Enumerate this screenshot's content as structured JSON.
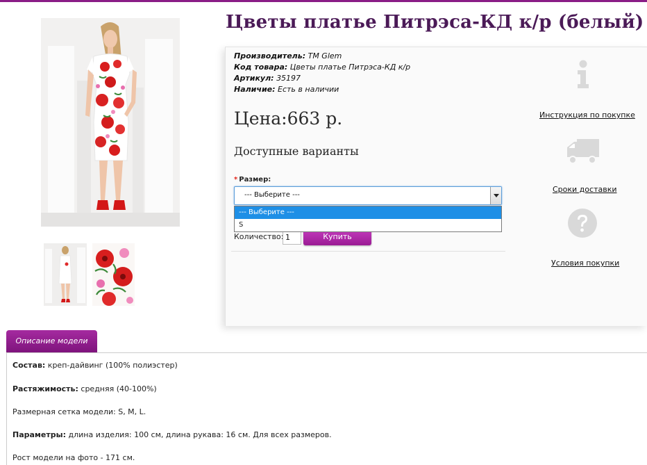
{
  "product": {
    "title": "Цветы платье Питрэса-КД к/р (белый)",
    "meta": [
      {
        "key": "Производитель:",
        "value": "ТМ Glem"
      },
      {
        "key": "Код товара:",
        "value": "Цветы платье Питрэса-КД к/р"
      },
      {
        "key": "Артикул:",
        "value": "35197"
      },
      {
        "key": "Наличие:",
        "value": "Есть в наличии"
      }
    ],
    "price": "Цена:663 р.",
    "variants_title": "Доступные варианты"
  },
  "options": {
    "required_mark": "*",
    "size_label": "Размер:",
    "size_selected": "--- Выберите ---",
    "size_options": [
      "--- Выберите ---",
      "S"
    ]
  },
  "purchase": {
    "qty_label": "Количество:",
    "qty_value": "1",
    "buy_label": "Купить"
  },
  "side_links": {
    "instruction": "Инструкция по покупке",
    "delivery": "Сроки доставки",
    "conditions": "Условия покупки"
  },
  "tabs": {
    "description": "Описание модели"
  },
  "description": [
    {
      "key": "Состав:",
      "value": " креп-дайвинг (100% полиэстер)"
    },
    {
      "key": "Растяжимость:",
      "value": " средняя (40-100%)"
    },
    {
      "key": "",
      "value": "Размерная сетка модели: S, M, L."
    },
    {
      "key": "Параметры:",
      "value": " длина изделия: 100 см, длина рукава: 16 см. Для всех размеров."
    },
    {
      "key": "",
      "value": "Рост модели на фото - 171 см."
    }
  ],
  "colors": {
    "accent": "#8a1c86",
    "title": "#4b1a57",
    "icon_gray": "#d9d9d9",
    "select_highlight": "#1e8fe6"
  },
  "icons": {
    "info": "info-icon",
    "delivery": "truck-icon",
    "conditions": "question-icon"
  }
}
